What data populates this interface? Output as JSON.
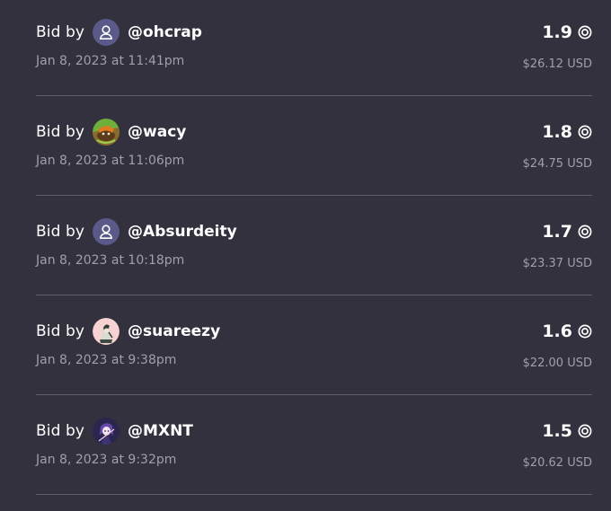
{
  "bids": [
    {
      "label": "Bid by",
      "avatar": "default-user-icon",
      "username": "@ohcrap",
      "timestamp": "Jan 8, 2023 at 11:41pm",
      "amount": "1.9",
      "currency_icon": "token-icon",
      "usd": "$26.12 USD"
    },
    {
      "label": "Bid by",
      "avatar": "wacy-avatar",
      "username": "@wacy",
      "timestamp": "Jan 8, 2023 at 11:06pm",
      "amount": "1.8",
      "currency_icon": "token-icon",
      "usd": "$24.75 USD"
    },
    {
      "label": "Bid by",
      "avatar": "default-user-icon",
      "username": "@Absurdeity",
      "timestamp": "Jan 8, 2023 at 10:18pm",
      "amount": "1.7",
      "currency_icon": "token-icon",
      "usd": "$23.37 USD"
    },
    {
      "label": "Bid by",
      "avatar": "suareezy-avatar",
      "username": "@suareezy",
      "timestamp": "Jan 8, 2023 at 9:38pm",
      "amount": "1.6",
      "currency_icon": "token-icon",
      "usd": "$22.00 USD"
    },
    {
      "label": "Bid by",
      "avatar": "mxnt-avatar",
      "username": "@MXNT",
      "timestamp": "Jan 8, 2023 at 9:32pm",
      "amount": "1.5",
      "currency_icon": "token-icon",
      "usd": "$20.62 USD"
    }
  ],
  "colors": {
    "background": "#33313d",
    "text_primary": "#ffffff",
    "text_secondary": "#a19fab",
    "divider": "#5f5d69",
    "default_avatar_bg": "#5b5989"
  }
}
